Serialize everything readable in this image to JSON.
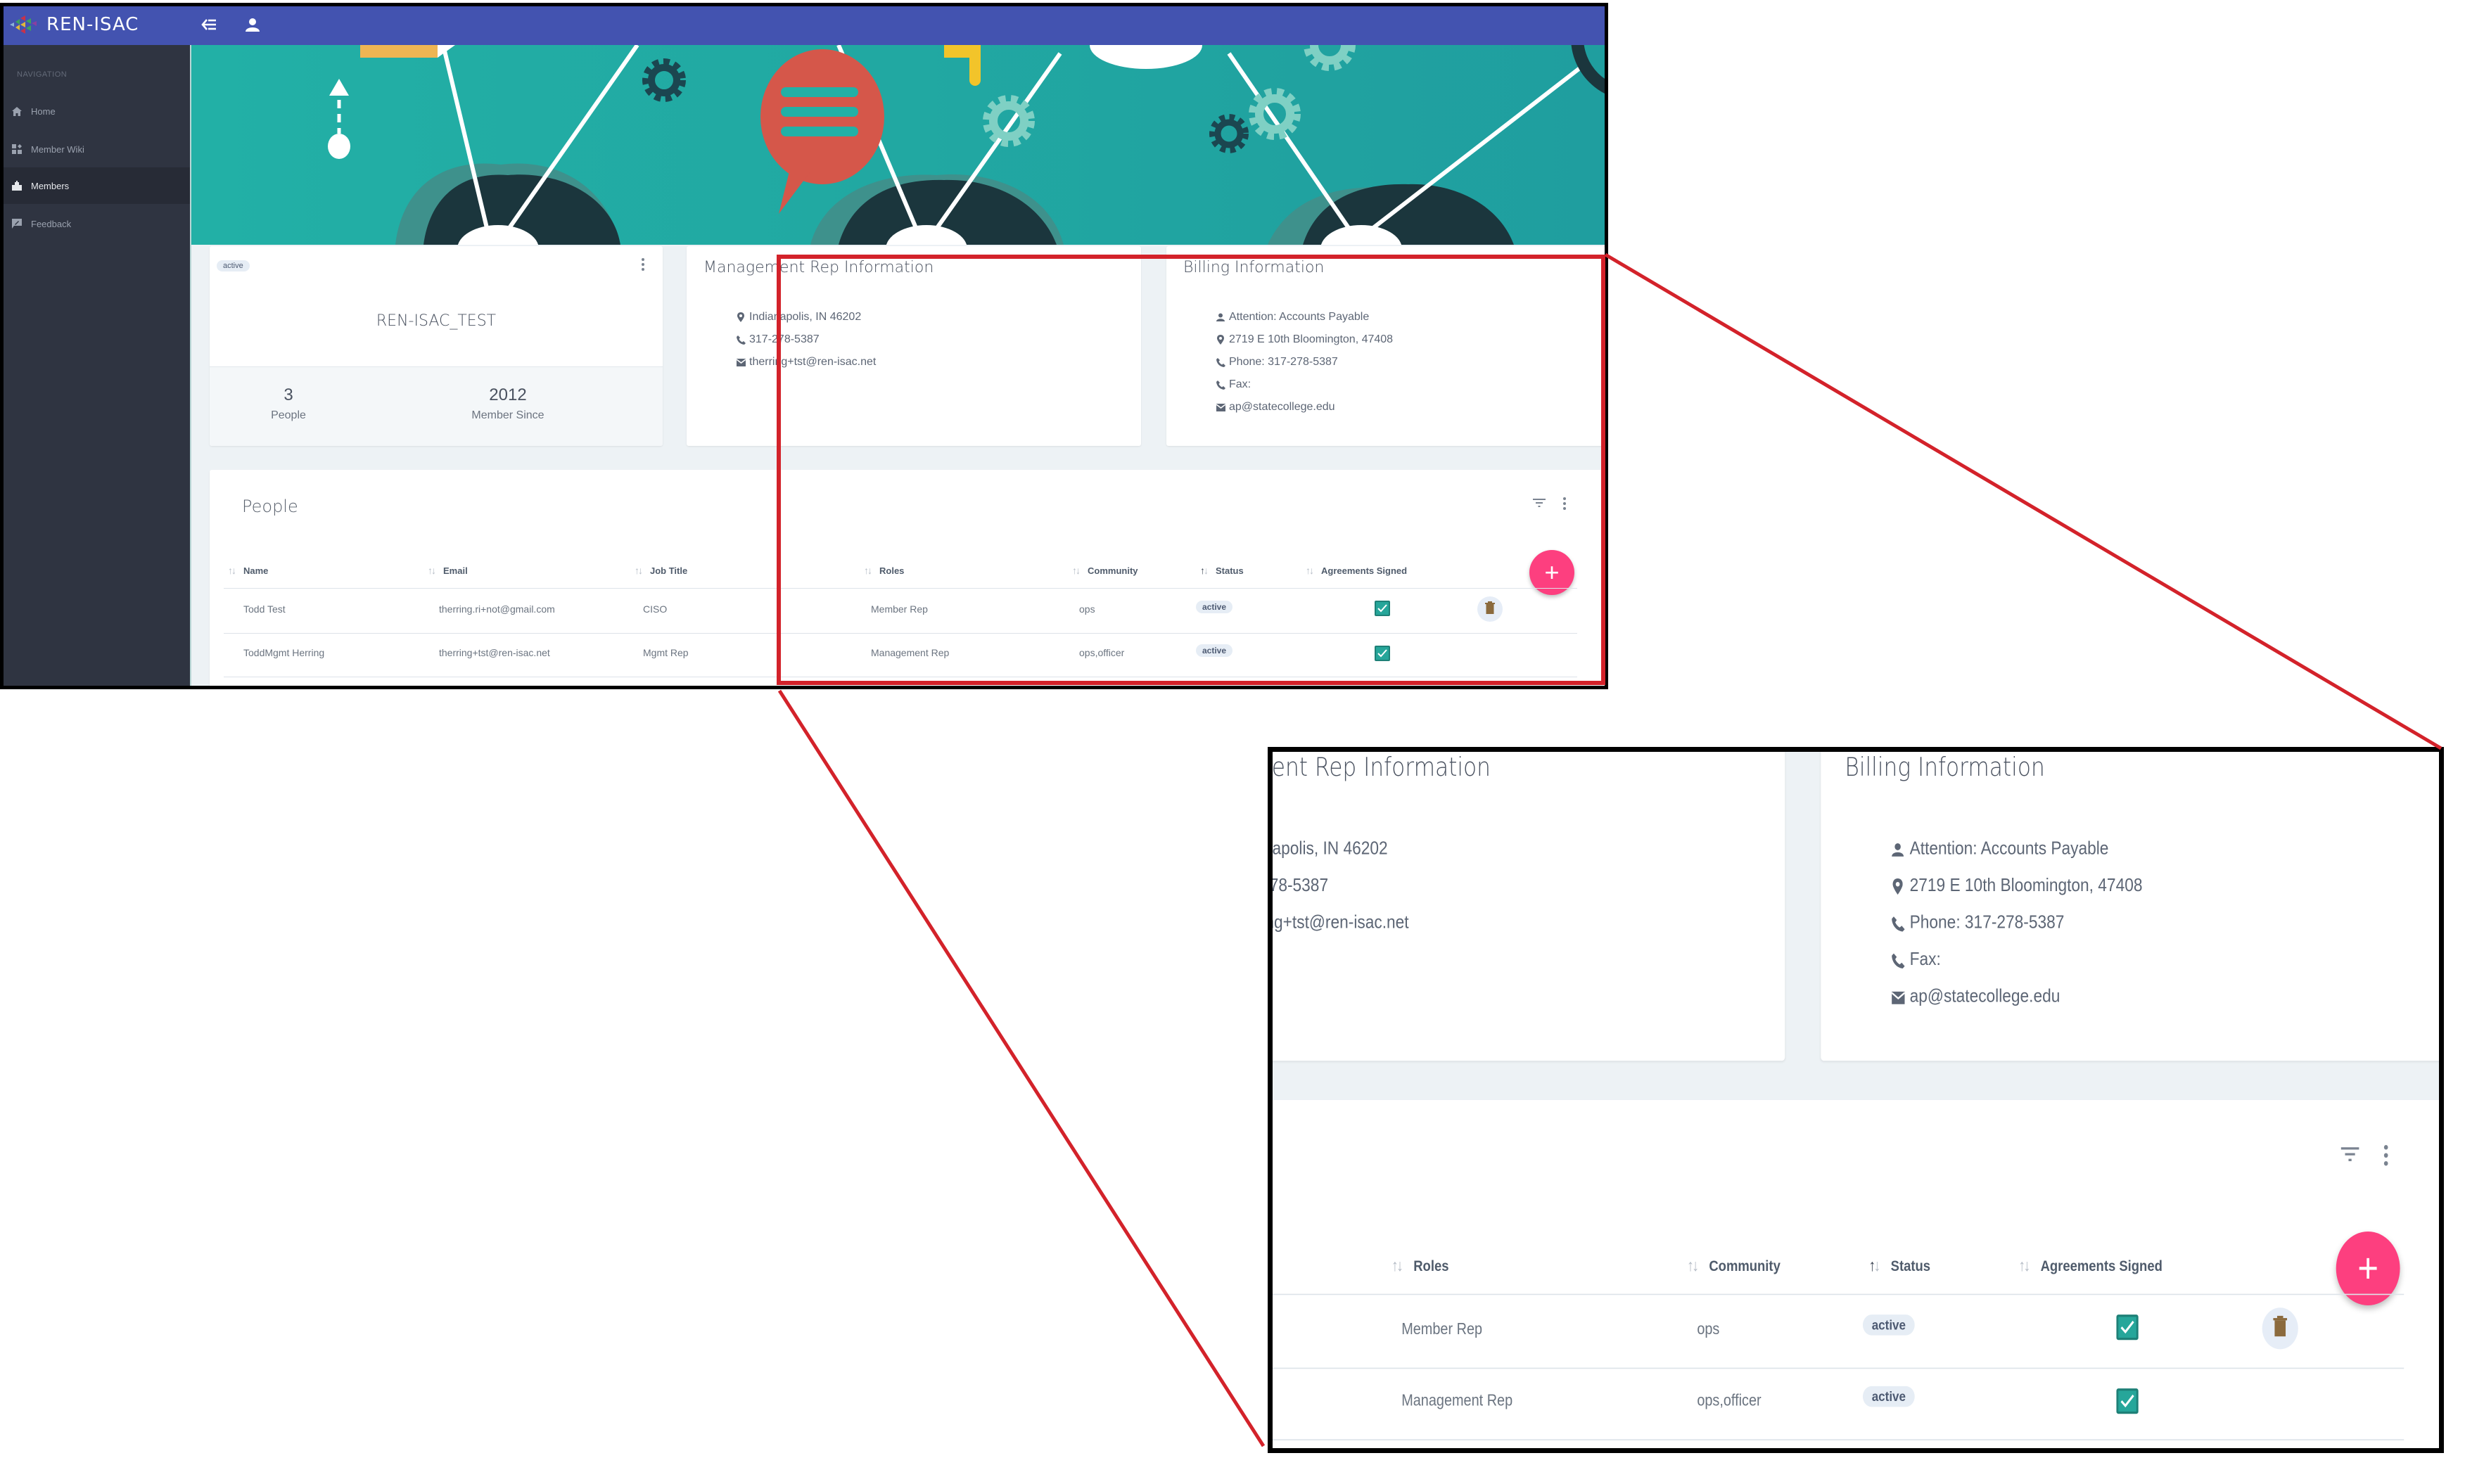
{
  "app": {
    "brand": "REN-ISAC",
    "topbar_icons": [
      "menu-collapse-icon",
      "user-icon"
    ]
  },
  "sidebar": {
    "section_label": "NAVIGATION",
    "items": [
      {
        "label": "Home",
        "icon": "home-icon",
        "active": false
      },
      {
        "label": "Member Wiki",
        "icon": "widgets-icon",
        "active": false
      },
      {
        "label": "Members",
        "icon": "building-icon",
        "active": true
      },
      {
        "label": "Feedback",
        "icon": "feedback-icon",
        "active": false
      }
    ]
  },
  "profile": {
    "status": "active",
    "name": "REN-ISAC_TEST",
    "people_count": "3",
    "people_label": "People",
    "member_since": "2012",
    "member_since_label": "Member Since"
  },
  "management_rep": {
    "title": "Management Rep Information",
    "location": "Indianapolis, IN 46202",
    "phone": "317-278-5387",
    "email": "therring+tst@ren-isac.net"
  },
  "billing": {
    "title": "Billing Information",
    "attention": "Attention: Accounts Payable",
    "address": "2719 E 10th Bloomington, 47408",
    "phone": "Phone: 317-278-5387",
    "fax": "Fax:",
    "email": "ap@statecollege.edu"
  },
  "people": {
    "title": "People",
    "columns": [
      {
        "label": "Name",
        "sorted": false
      },
      {
        "label": "Email",
        "sorted": false
      },
      {
        "label": "Job Title",
        "sorted": false
      },
      {
        "label": "Roles",
        "sorted": false
      },
      {
        "label": "Community",
        "sorted": false
      },
      {
        "label": "Status",
        "sorted": true
      },
      {
        "label": "Agreements Signed",
        "sorted": false
      }
    ],
    "rows": [
      {
        "name": "Todd Test",
        "email": "therring.ri+not@gmail.com",
        "job_title": "CISO",
        "roles": "Member Rep",
        "community": "ops",
        "status": "active",
        "agreements_signed": true,
        "deletable": true
      },
      {
        "name": "ToddMgmt Herring",
        "email": "therring+tst@ren-isac.net",
        "job_title": "Mgmt Rep",
        "roles": "Management Rep",
        "community": "ops,officer",
        "status": "active",
        "agreements_signed": true,
        "deletable": false
      }
    ],
    "add_button": "+"
  },
  "colors": {
    "topbar": "#4353b0",
    "sidebar": "#2f3441",
    "banner_teal": "#22b0a6",
    "fab": "#fd3f7f",
    "checkbox": "#26a69a",
    "annotation_red": "#d3222a"
  }
}
